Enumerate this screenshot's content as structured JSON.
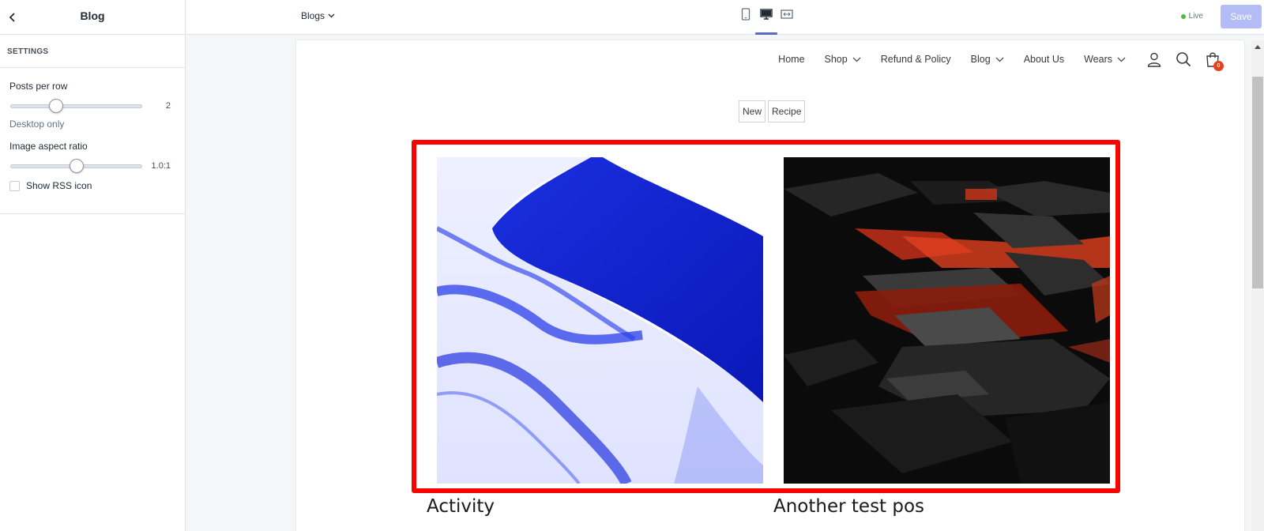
{
  "sidebar": {
    "title": "Blog",
    "section_heading": "SETTINGS",
    "posts_per_row": {
      "label": "Posts per row",
      "value": "2",
      "help": "Desktop only",
      "level": 0.33
    },
    "aspect_ratio": {
      "label": "Image aspect ratio",
      "value": "1.0:1",
      "level": 0.5
    },
    "rss": {
      "label": "Show RSS icon",
      "checked": false
    }
  },
  "topbar": {
    "page_select": "Blogs",
    "status": "Live",
    "save_label": "Save",
    "colors": {
      "accent": "#5c6ac4",
      "save_bg": "#b3bcf5",
      "live": "#50b83c"
    }
  },
  "store": {
    "nav": [
      {
        "label": "Home",
        "dropdown": false
      },
      {
        "label": "Shop",
        "dropdown": true
      },
      {
        "label": "Refund & Policy",
        "dropdown": false
      },
      {
        "label": "Blog",
        "dropdown": true
      },
      {
        "label": "About Us",
        "dropdown": false
      },
      {
        "label": "Wears",
        "dropdown": true
      }
    ],
    "cart_count": "0",
    "tags": [
      "New",
      "Recipe"
    ],
    "posts": [
      {
        "title": "Activity",
        "image": "blue-fabric-abstract"
      },
      {
        "title": "Another test pos",
        "image": "dark-red-cubes-abstract"
      }
    ],
    "highlight_color": "#ff0000"
  }
}
